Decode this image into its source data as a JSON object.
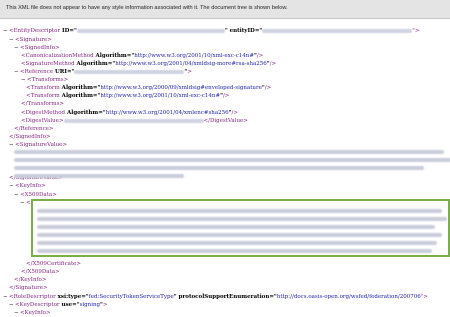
{
  "banner": {
    "text": "This XML file does not appear to have any style information associated with it. The document tree is shown below."
  },
  "lines": [
    {
      "t": "-",
      "open": "EntityDescriptor",
      "attrs": " ID=\"",
      "after": "\" entityID=\"",
      "after2": "\">"
    },
    {
      "t": "-",
      "open": "Signature"
    },
    {
      "t": "-",
      "open": "SignedInfo"
    },
    {
      "t": "",
      "open": "CanonicalizationMethod",
      "attr": "Algorithm",
      "val": "http://www.w3.org/2001/10/xml-exc-c14n#",
      "close": "/>"
    },
    {
      "t": "",
      "open": "SignatureMethod",
      "attr": "Algorithm",
      "val": "http://www.w3.org/2001/04/xmldsig-more#rsa-sha256",
      "close": "/>"
    },
    {
      "t": "-",
      "open": "Reference",
      "attr": "URI",
      "val": "",
      "close": ">"
    },
    {
      "t": "-",
      "open": "Transforms"
    },
    {
      "t": "",
      "open": "Transform",
      "attr": "Algorithm",
      "val": "http://www.w3.org/2000/09/xmldsig#enveloped-signature",
      "close": "/>"
    },
    {
      "t": "",
      "open": "Transform",
      "attr": "Algorithm",
      "val": "http://www.w3.org/2001/10/xml-exc-c14n#",
      "close": "/>"
    },
    {
      "t": "",
      "text": "</Transforms>"
    },
    {
      "t": "",
      "open": "DigestMethod",
      "attr": "Algorithm",
      "val": "http://www.w3.org/2001/04/xmlenc#sha256",
      "close": "/>"
    },
    {
      "t": "",
      "open": "DigestValue",
      "close": ">",
      "tail": "</DigestValue>"
    },
    {
      "t": "",
      "text": "</Reference>"
    },
    {
      "t": "",
      "text": "</SignedInfo>"
    },
    {
      "t": "-",
      "open": "SignatureValue"
    },
    {
      "t": "",
      "text": "</SignatureValue>"
    },
    {
      "t": "-",
      "open": "KeyInfo"
    },
    {
      "t": "-",
      "open": "X509Data"
    },
    {
      "t": "-",
      "open": "X509Certificate"
    },
    {
      "t": "",
      "text": "</X509Certificate>"
    },
    {
      "t": "",
      "text": "</X509Data>"
    },
    {
      "t": "",
      "text": "</KeyInfo>"
    },
    {
      "t": "",
      "text": "</Signature>"
    },
    {
      "t": "-",
      "open": "RoleDescriptor",
      "attrs": " xsi:type=\"",
      "mid": "fed:SecurityTokenServiceType",
      "after": "\" protocolSupportEnumeration=\"",
      "mid2": "http://docs.oasis-open.org/wsfed/federation/200706",
      "after2": "\">"
    },
    {
      "t": "-",
      "open": "KeyDescriptor",
      "attr": "use",
      "val": "signing",
      "close": ">"
    },
    {
      "t": "-",
      "open": "KeyInfo"
    }
  ]
}
